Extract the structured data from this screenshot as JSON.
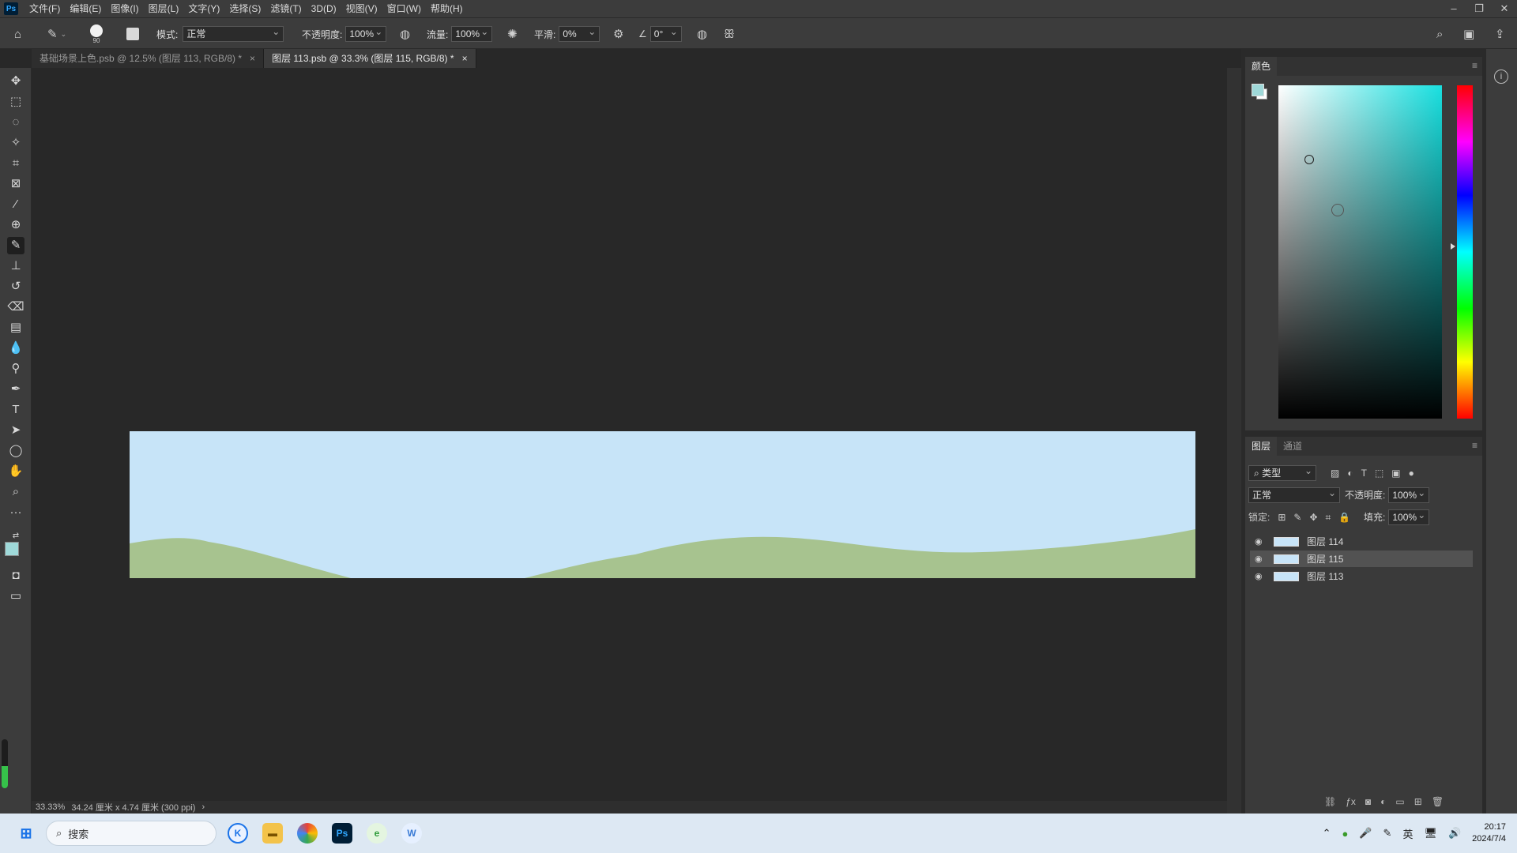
{
  "app": {
    "logo_text": "Ps",
    "menu": [
      "文件(F)",
      "编辑(E)",
      "图像(I)",
      "图层(L)",
      "文字(Y)",
      "选择(S)",
      "滤镜(T)",
      "3D(D)",
      "视图(V)",
      "窗口(W)",
      "帮助(H)"
    ]
  },
  "options": {
    "brush_size": "90",
    "mode_label": "模式:",
    "mode_value": "正常",
    "opacity_label": "不透明度:",
    "opacity_value": "100%",
    "flow_label": "流量:",
    "flow_value": "100%",
    "smooth_label": "平滑:",
    "smooth_value": "0%",
    "angle_value": "0°"
  },
  "tabs": [
    {
      "label": "基础场景上色.psb @ 12.5% (图层 113, RGB/8) *",
      "close": "×"
    },
    {
      "label": "图层 113.psb @ 33.3% (图层 115, RGB/8) *",
      "close": "×"
    }
  ],
  "status": {
    "zoom": "33.33%",
    "doc_info": "34.24 厘米 x 4.74 厘米 (300 ppi)",
    "arrow": "›"
  },
  "color_panel": {
    "title": "颜色",
    "fg_color": "#9fd9d9",
    "bg_color": "#ffffff",
    "hue_color": "#19e0e0"
  },
  "layers_panel": {
    "tabs": [
      "图层",
      "通道"
    ],
    "filter_label": "类型",
    "blend_mode": "正常",
    "opacity_label": "不透明度:",
    "opacity_value": "100%",
    "lock_label": "锁定:",
    "fill_label": "填充:",
    "fill_value": "100%",
    "layers": [
      {
        "name": "图层 114",
        "selected": false
      },
      {
        "name": "图层 115",
        "selected": true
      },
      {
        "name": "图层 113",
        "selected": false
      }
    ]
  },
  "canvas": {
    "sky_color": "#c7e4f8",
    "hill_color": "#a7c38f"
  },
  "taskbar": {
    "search_placeholder": "搜索",
    "ime": "英",
    "time": "20:17",
    "date": "2024/7/4"
  }
}
